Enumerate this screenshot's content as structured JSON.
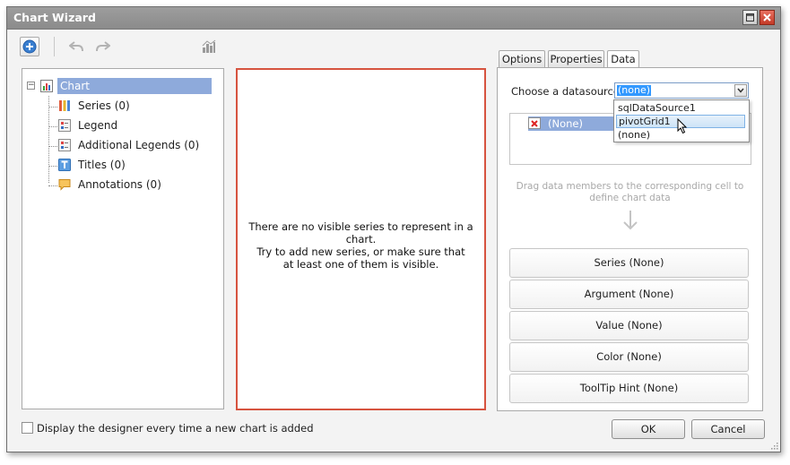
{
  "window": {
    "title": "Chart Wizard"
  },
  "tree": {
    "root": "Chart",
    "items": [
      {
        "label": "Series (0)",
        "icon": "series-icon"
      },
      {
        "label": "Legend",
        "icon": "legend-icon"
      },
      {
        "label": "Additional Legends (0)",
        "icon": "additional-legends-icon"
      },
      {
        "label": "Titles (0)",
        "icon": "titles-icon"
      },
      {
        "label": "Annotations (0)",
        "icon": "annotations-icon"
      }
    ]
  },
  "preview": {
    "message_lines": [
      "There are no visible series to represent in a chart.",
      "Try to add new series, or make sure that",
      "at least one of them is visible."
    ]
  },
  "tabs": [
    {
      "label": "Options"
    },
    {
      "label": "Properties"
    },
    {
      "label": "Data",
      "active": true
    }
  ],
  "data_panel": {
    "datasource_label": "Choose a datasource:",
    "datasource_value": "(none)",
    "dropdown_options": [
      "sqlDataSource1",
      "pivotGrid1",
      "(none)"
    ],
    "highlighted_option": "pivotGrid1",
    "member_row": "(None)",
    "hint_lines": [
      "Drag data members to the corresponding cell to",
      "define chart data"
    ],
    "cells": [
      "Series (None)",
      "Argument (None)",
      "Value (None)",
      "Color (None)",
      "ToolTip Hint (None)"
    ]
  },
  "footer": {
    "checkbox_label": "Display the designer every time a new chart is added",
    "ok_label": "OK",
    "cancel_label": "Cancel"
  },
  "colors": {
    "selection": "#8eaadb",
    "preview_border": "#d6533f",
    "accent_blue": "#3399ff",
    "close_button": "#c33a27"
  }
}
